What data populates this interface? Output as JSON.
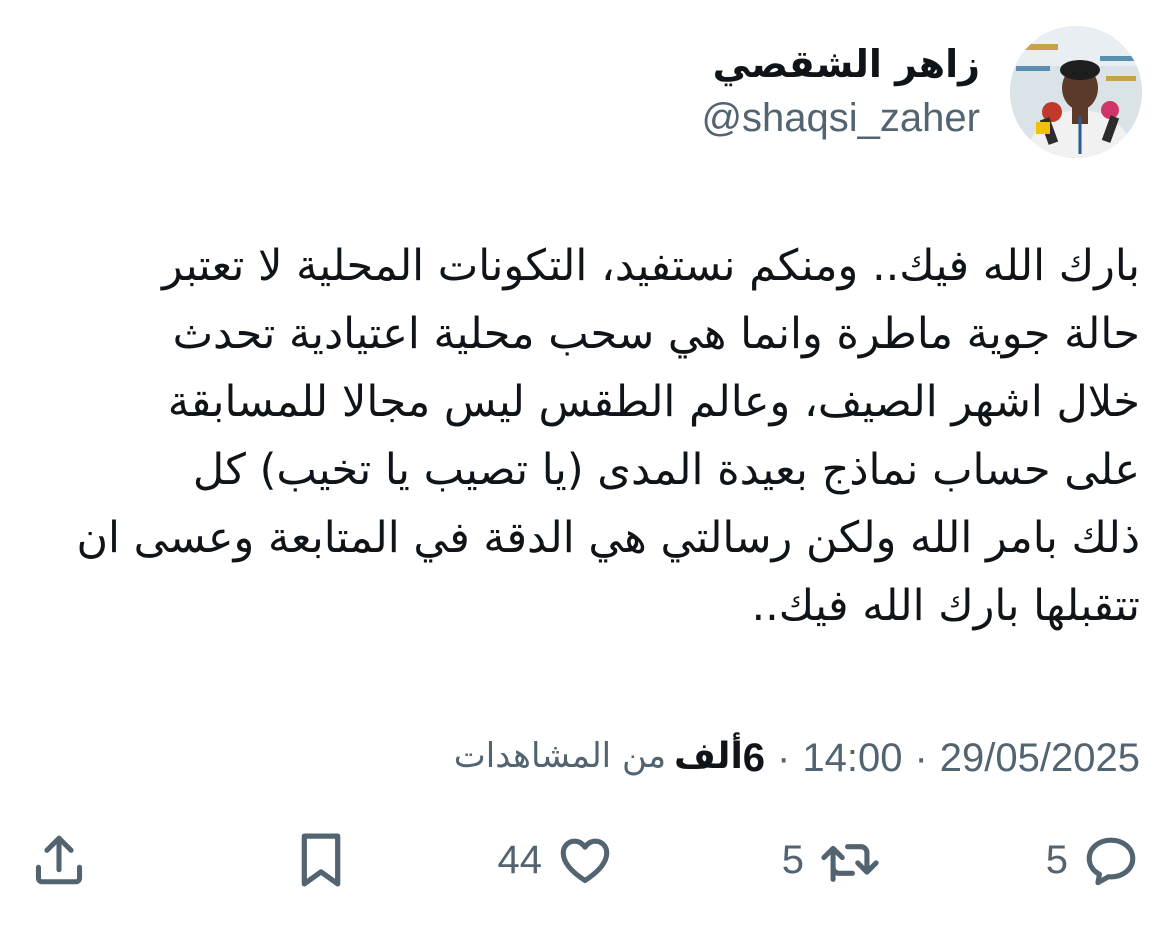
{
  "user": {
    "display_name": "زاهر الشقصي",
    "handle": "@shaqsi_zaher",
    "avatar_icon": "profile-photo"
  },
  "tweet": {
    "lines": [
      "بارك الله فيك.. ومنكم نستفيد، التكونات المحلية لا تعتبر",
      "حالة جوية ماطرة وانما هي سحب محلية اعتيادية تحدث",
      "خلال اشهر الصيف، وعالم الطقس ليس مجالا للمسابقة",
      "على حساب نماذج بعيدة المدى (يا تصيب يا تخيب) كل",
      "ذلك بامر الله ولكن رسالتي هي الدقة في المتابعة وعسى ان",
      "تتقبلها بارك الله فيك.."
    ]
  },
  "meta": {
    "date": "29/05/2025",
    "separator": "·",
    "time": "14:00",
    "views_count": "6",
    "views_unit": "ألف",
    "views_label": "من المشاهدات"
  },
  "actions": {
    "reply_count": "5",
    "retweet_count": "5",
    "like_count": "44",
    "icons": [
      "reply-icon",
      "retweet-icon",
      "like-icon",
      "bookmark-icon",
      "share-icon"
    ]
  },
  "colors": {
    "text_primary": "#0f1419",
    "text_secondary": "#536471",
    "background": "#ffffff"
  }
}
